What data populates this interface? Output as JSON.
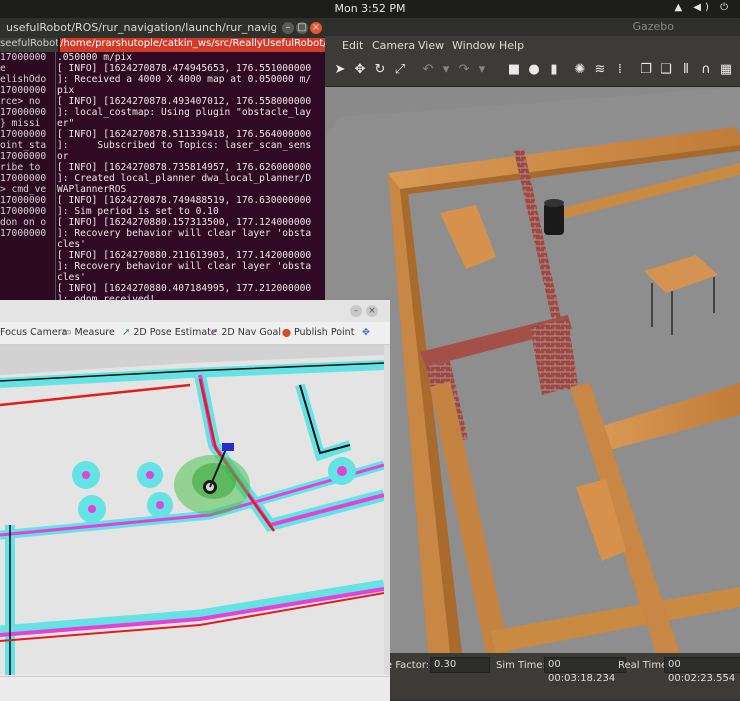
{
  "topbar": {
    "clock": "Mon   3:52 PM",
    "tray_icons": "▲ ◀) ⏻"
  },
  "gazebo": {
    "window_title": "Gazebo",
    "menu": [
      "Edit",
      "Camera",
      "View",
      "Window",
      "Help"
    ],
    "status": {
      "factor_label": "e Factor:",
      "factor_value": "0.30",
      "sim_label": "Sim Time:",
      "sim_value": "00 00:03:18.234",
      "real_label": "Real Time:",
      "real_value": "00 00:02:23.554"
    }
  },
  "terminal": {
    "title": "usefulRobot/ROS/rur_navigation/launch/rur_navigation.laun...",
    "tab1": "seefulRobot/",
    "tab2": "/home/prarshutople/catkin_ws/src/ReallyUsefulRobot/R",
    "side_lines": [
      "17000000",
      "e",
      "elishOdo",
      "",
      "17000000",
      "",
      "rce> no",
      "",
      "17000000",
      "} missi",
      "",
      "17000000",
      "oint_sta",
      "17000000",
      "ribe to",
      "",
      "17000000",
      "> cmd_ve",
      "17000000",
      "",
      "17000000",
      "don on o",
      "17000000"
    ],
    "lines": [
      ".050000 m/pix",
      "[ INFO] [1624270878.474945653, 176.551000000",
      "]: Received a 4000 X 4000 map at 0.050000 m/",
      "pix",
      "[ INFO] [1624270878.493407012, 176.558000000",
      "]: local_costmap: Using plugin \"obstacle_lay",
      "er\"",
      "[ INFO] [1624270878.511339418, 176.564000000",
      "]:     Subscribed to Topics: laser_scan_sens",
      "or",
      "[ INFO] [1624270878.735814957, 176.626000000",
      "]: Created local_planner dwa_local_planner/D",
      "WAPlannerROS",
      "[ INFO] [1624270878.749488519, 176.630000000",
      "]: Sim period is set to 0.10",
      "[ INFO] [1624270880.157313500, 177.124000000",
      "]: Recovery behavior will clear layer 'obsta",
      "cles'",
      "[ INFO] [1624270880.211613903, 177.142000000",
      "]: Recovery behavior will clear layer 'obsta",
      "cles'",
      "[ INFO] [1624270880.407184995, 177.212000000",
      "]: odom received!"
    ]
  },
  "rviz": {
    "tools": [
      {
        "icon": "✥",
        "label": "Focus Camera"
      },
      {
        "icon": "▭",
        "label": "Measure"
      },
      {
        "icon": "➚",
        "label": "2D Pose Estimate"
      },
      {
        "icon": "➚",
        "label": "2D Nav Goal"
      },
      {
        "icon": "⬤",
        "label": "Publish Point"
      }
    ]
  },
  "colors": {
    "terminal_bg": "#300a24",
    "active_tab": "#d13b2a",
    "wood": "#c98a42",
    "brick": "#9a4a44",
    "costmap_cyan": "#63e3e3",
    "costmap_magenta": "#e242d8",
    "laser_red": "#e21d1d",
    "particles": "#4ec24e"
  }
}
